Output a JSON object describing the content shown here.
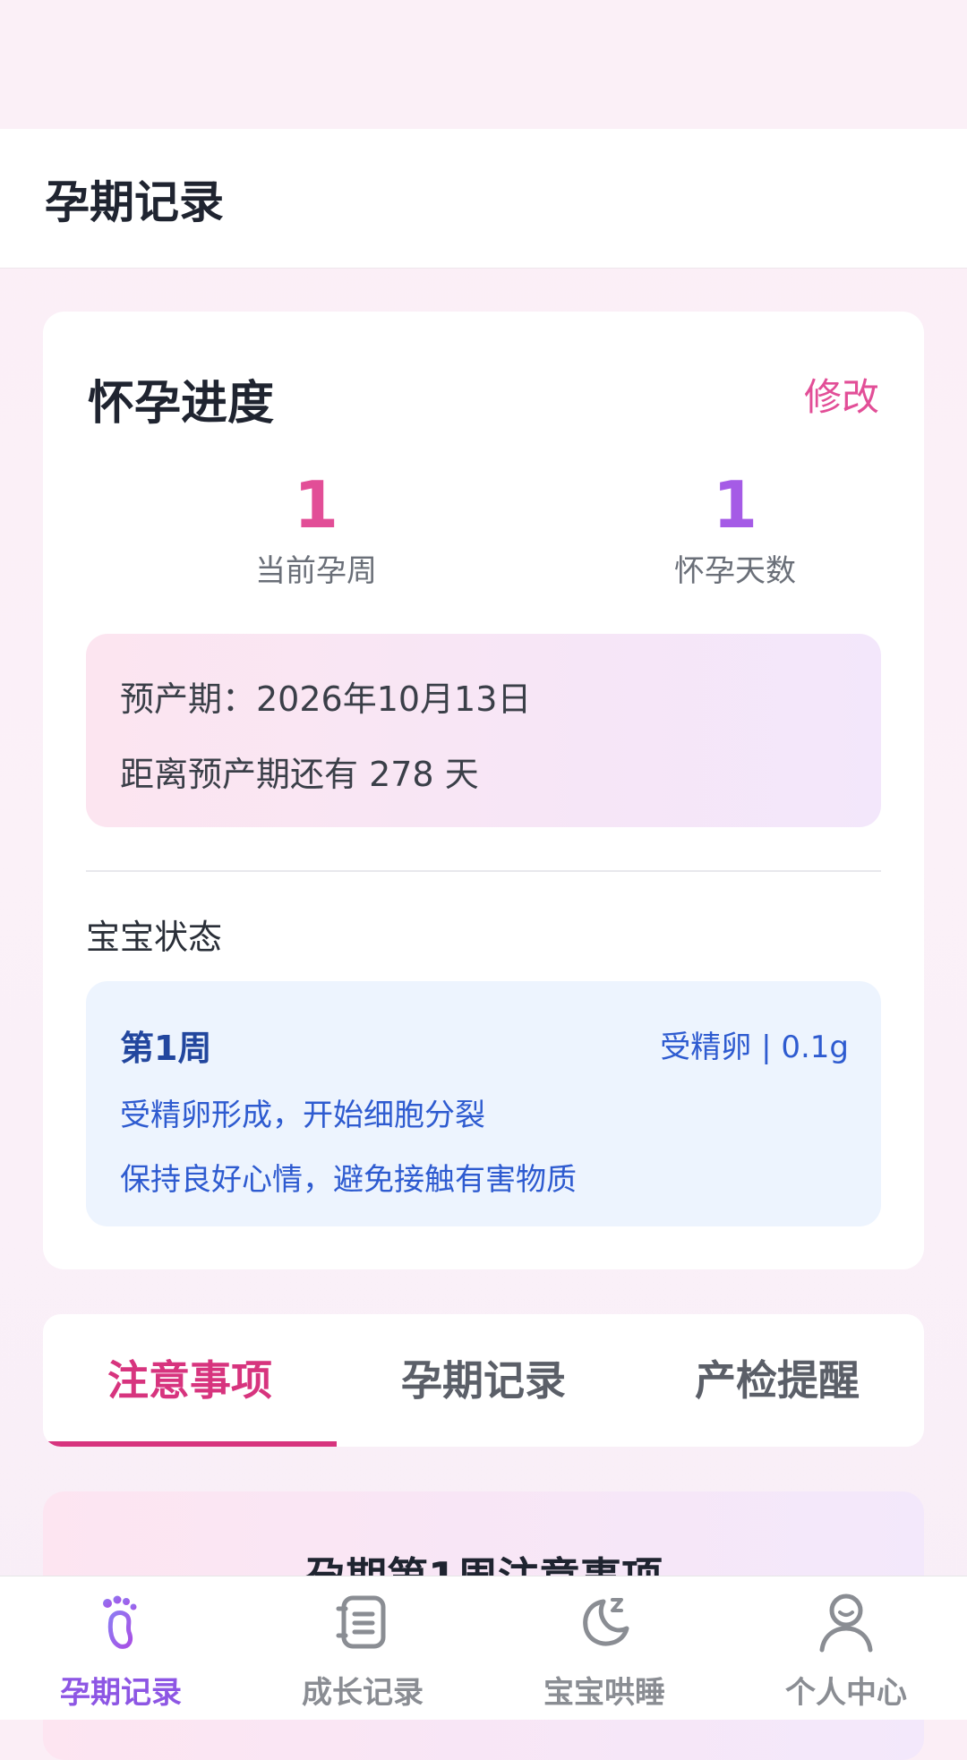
{
  "header": {
    "title": "孕期记录"
  },
  "progress_card": {
    "title": "怀孕进度",
    "edit_label": "修改",
    "current_week": {
      "value": "1",
      "label": "当前孕周"
    },
    "pregnancy_days": {
      "value": "1",
      "label": "怀孕天数"
    },
    "due_date_text": "预产期：2026年10月13日",
    "countdown_text": "距离预产期还有 278 天",
    "baby_status_title": "宝宝状态",
    "week_info": {
      "week_label": "第1周",
      "meta": "受精卵 | 0.1g",
      "description": "受精卵形成，开始细胞分裂",
      "tip": "保持良好心情，避免接触有害物质"
    }
  },
  "tabs": [
    {
      "label": "注意事项",
      "active": true
    },
    {
      "label": "孕期记录",
      "active": false
    },
    {
      "label": "产检提醒",
      "active": false
    }
  ],
  "notice": {
    "title": "孕期第1周注意事项"
  },
  "tabbar": {
    "items": [
      {
        "label": "孕期记录",
        "icon": "footprint-icon",
        "active": true
      },
      {
        "label": "成长记录",
        "icon": "notebook-icon",
        "active": false
      },
      {
        "label": "宝宝哄睡",
        "icon": "moon-icon",
        "active": false
      },
      {
        "label": "个人中心",
        "icon": "user-icon",
        "active": false
      }
    ]
  },
  "colors": {
    "accent_pink": "#e24e97",
    "accent_purple": "#a55be6",
    "tab_active": "#d7347e",
    "tabbar_active": "#8d56e4",
    "info_blue": "#2e5bd0"
  }
}
